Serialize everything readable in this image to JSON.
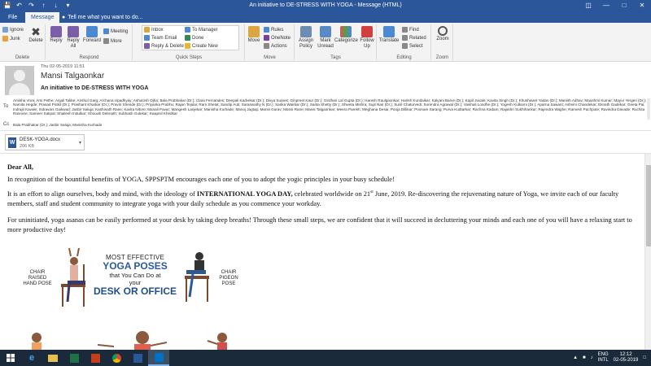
{
  "window": {
    "title": "An initiative to DE-STRESS WITH YOGA  -  Message (HTML)"
  },
  "tabs": {
    "file": "File",
    "message": "Message",
    "tell_me": "Tell me what you want to do..."
  },
  "ribbon": {
    "delete_group": {
      "ignore": "Ignore",
      "junk": "Junk",
      "delete": "Delete",
      "label": "Delete"
    },
    "respond_group": {
      "reply": "Reply",
      "reply_all": "Reply All",
      "forward": "Forward",
      "meeting": "Meeting",
      "more": "More",
      "label": "Respond"
    },
    "quick_steps": {
      "inbox": "Inbox",
      "team_email": "Team Email",
      "reply_delete": "Reply & Delete",
      "to_manager": "To Manager",
      "done": "Done",
      "create_new": "Create New",
      "label": "Quick Steps"
    },
    "move_group": {
      "move": "Move",
      "rules": "Rules",
      "onenote": "OneNote",
      "actions": "Actions",
      "label": "Move"
    },
    "tags_group": {
      "assign_policy": "Assign Policy",
      "mark_unread": "Mark Unread",
      "categorize": "Categorize",
      "follow_up": "Follow Up",
      "label": "Tags"
    },
    "editing_group": {
      "translate": "Translate",
      "find": "Find",
      "related": "Related",
      "select": "Select",
      "label": "Editing"
    },
    "zoom_group": {
      "zoom": "Zoom",
      "label": "Zoom"
    }
  },
  "message": {
    "date": "Thu 02-05-2019 11:51",
    "sender": "Mansi Talgaonkar",
    "subject": "An initiative to DE-STRESS WITH YOGA",
    "to_label": "To",
    "to_recipients": "Amisha Vora; Ami Pethe; Anjali Takke; Anshul Garg; Archana Upadhyay; Ashutosh Ojha; Bala Prabhakar (Dr.); Clara Fernandes; Deepali Kadvekar (Dr.); Divya Suares; Ginpreet Kaur (Dr.); Girdhari Lal Gupta (Dr.); Haresh Raulgaonkar; Harish Kundaikar; Kalyani Barve (Dr.); Kapil Juvale; Kavita Singh (Dr.); Khushwant Yadav (Dr.); Manish Adhav; Maushmi Kumar; Mayur Yergeri (Dr.); Namita Hegde; Prasad Potkil (Dr.); Prashant Kharkar (Dr.); Pravin Shende (Dr.); Priyanka Prabhu; Rajan Tejulai; Ram Shelat; Sandip Auti; Saraswathy N (Dr.); Sarika Wairkar (Dr.); Sarita Shetty (Dr.); Shweta Mishra; Sujit Nair (Dr.); Sunil Chaturvedi; Surendra Agrawal (Dr.); Vaishali Londhe (Dr.); Yogesh Kulkarni (Dr.); Aparna Sawant; Ashvini Chandekar; Eknath Gadekar; Geeta Pai; Indrajit Kavale; Indravani Gaikwad; Jasbir Saluja; Kashinath Rane; Kavita Nitore; Manali Pavar; Mangesh Lanjekar; Manisha Kurhade; Manoj Jagtap; Mansi Gurav; Mansi Rane; Mansi Talgaonkar; Meera Parekh; Meghana Desai; Pooja Dillikar; Poonam Sarang; Purva Kudtarkar; Rachna Kadam; Rajashri Sukhthankar; Rajendra Waghe; Ramesh Pachpute; Ravindra Davade; Ruchita Raorane; Sameer Sakpal; Shailesh Indulkar; Shouvik Debnath; Subhash Gulekar; Swapnil Khedkar",
    "cc_label": "Cc",
    "cc_recipients": "Bala Prabhakar (Dr.); Jasbir Saluja; Manisha Kurhade"
  },
  "attachment": {
    "name": "DESK-YOGA.docx",
    "size": "206 KB",
    "icon_letter": "W"
  },
  "body": {
    "greeting": "Dear All,",
    "p1": "In recognition of the bountiful benefits of YOGA, SPPSPTM encourages each one of you to adopt the yogic principles in your busy schedule!",
    "p2a": "It is an effort to align ourselves, body and mind, with the ideology of ",
    "p2b": "INTERNATIONAL YOGA DAY,",
    "p2c": " celebrated worldwide on 21",
    "p2sup": "st",
    "p2d": " June, 2019. Re-discovering the rejuvenating nature of Yoga, we invite each of our faculty members, staff and student community to integrate yoga with your daily schedule as you commence your workday.",
    "p3": "For uninitiated, yoga asanas can be easily performed at your desk by taking deep breaths! Through these small steps, we are confident that it will succeed in decluttering your minds and each one of you will have a relaxing start to more productive day!"
  },
  "poster": {
    "left_label_1": "CHAIR",
    "left_label_2": "RAISED",
    "left_label_3": "HAND POSE",
    "right_label_1": "CHAIR",
    "right_label_2": "PIGEON",
    "right_label_3": "POSE",
    "headline_1": "MOST EFFECTIVE",
    "headline_2": "YOGA POSES",
    "headline_3": "that You Can Do at",
    "headline_4": "your",
    "headline_5": "DESK OR OFFICE"
  },
  "taskbar": {
    "lang_1": "ENG",
    "lang_2": "INTL",
    "time": "12:12",
    "date": "02-05-2019"
  },
  "colors": {
    "accent": "#2b579a",
    "taskbar": "#1a2a3a"
  }
}
